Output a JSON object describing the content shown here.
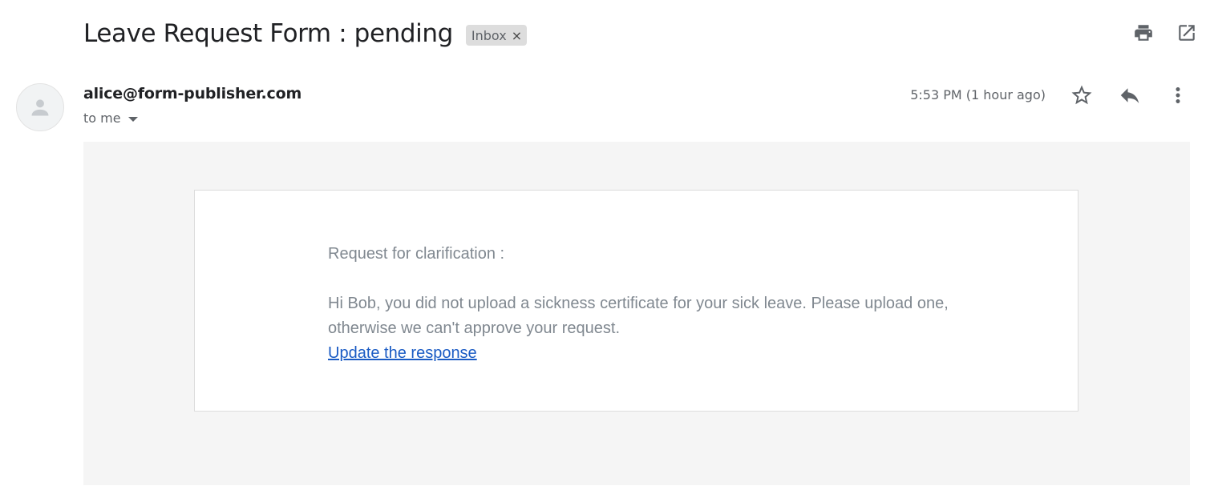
{
  "email": {
    "subject": "Leave Request Form : pending",
    "label": "Inbox",
    "label_remove": "×",
    "sender": "alice@form-publisher.com",
    "recipient": "to me",
    "time": "5:53 PM (1 hour ago)"
  },
  "toolbar": {
    "icons": [
      "print-icon",
      "open-in-new-window-icon"
    ]
  },
  "message_actions": {
    "icons": [
      "star-icon",
      "reply-icon",
      "more-options-icon"
    ]
  },
  "body": {
    "heading": "Request for clarification :",
    "message": "Hi Bob, you did not upload a sickness certificate for your sick leave. Please upload one, otherwise we can't approve your request.",
    "link_text": "Update the response"
  },
  "colors": {
    "link": "#1a5bc4",
    "body_text": "#808890",
    "body_background": "#f5f5f5",
    "chip_background": "#dddddd"
  }
}
